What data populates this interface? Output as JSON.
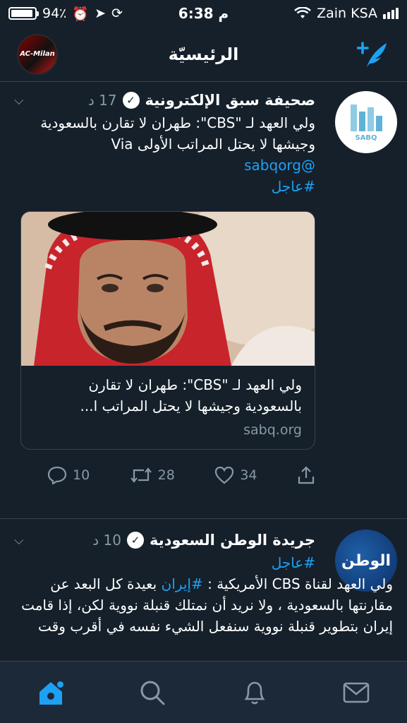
{
  "status_bar": {
    "battery": "94٪",
    "time": "6:38 م",
    "carrier": "Zain KSA"
  },
  "header": {
    "title": "الرئيسيّة",
    "avatar_text": "AC-Milan"
  },
  "tweets": [
    {
      "author": "صحيفة سبق الإلكترونية",
      "time": "17 د",
      "text": "ولي العهد لـ \"CBS\": طهران لا تقارن بالسعودية وجيشها لا يحتل المراتب الأولى Via",
      "mention": "@sabqorg",
      "hashtag": "#عاجل",
      "avatar_text": "SABQ",
      "card": {
        "title": "ولي العهد لـ \"CBS\": طهران لا تقارن بالسعودية وجيشها لا يحتل المراتب ا...",
        "domain": "sabq.org"
      },
      "replies": "10",
      "retweets": "28",
      "likes": "34"
    },
    {
      "author": "جريدة الوطن السعودية",
      "time": "10 د",
      "hashtag": "#عاجل",
      "text_prefix": "ولي العهد لقناة CBS الأمريكية : ",
      "hashtag_inline": "#إيران",
      "text_suffix": " بعيدة كل البعد عن مقارنتها بالسعودية ، ولا نريد أن نمتلك قنبلة نووية لكن، إذا قامت إيران بتطوير قنبلة نووية سنفعل الشيء نفسه في أقرب وقت",
      "avatar_text": "الوطن"
    }
  ],
  "colors": {
    "background": "#15202b",
    "accent": "#1da1f2",
    "muted": "#8899a6",
    "divider": "#38444d"
  }
}
